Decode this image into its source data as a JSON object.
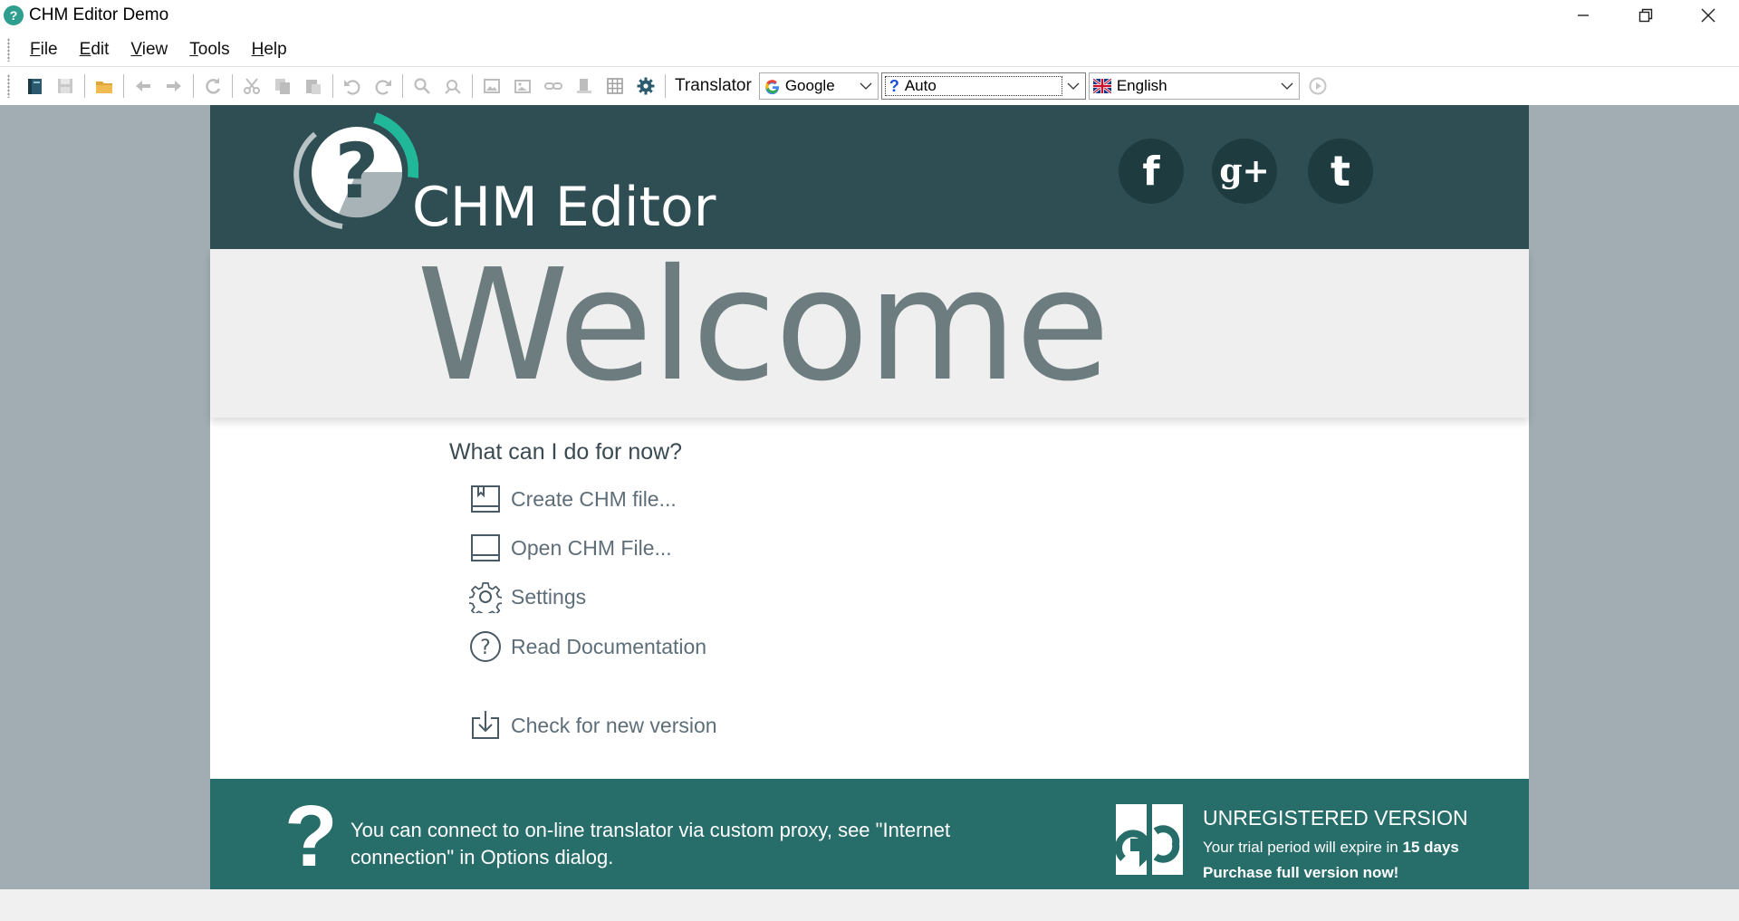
{
  "window": {
    "title": "CHM Editor Demo",
    "minimize_icon": "minimize-icon",
    "restore_icon": "restore-icon",
    "close_icon": "close-icon"
  },
  "menu": {
    "items": [
      {
        "accel": "F",
        "rest": "ile"
      },
      {
        "accel": "E",
        "rest": "dit"
      },
      {
        "accel": "V",
        "rest": "iew"
      },
      {
        "accel": "T",
        "rest": "ools"
      },
      {
        "accel": "H",
        "rest": "elp"
      }
    ]
  },
  "toolbar": {
    "translator_label": "Translator",
    "engine": "Google",
    "source_lang": "Auto",
    "target_lang": "English"
  },
  "header": {
    "brand": "CHM Editor",
    "social": [
      "f",
      "g+",
      "t"
    ]
  },
  "welcome": {
    "heading": "Welcome",
    "question": "What can I do for now?",
    "actions": [
      {
        "label": "Create CHM file...",
        "icon": "book-bookmark-icon"
      },
      {
        "label": "Open CHM File...",
        "icon": "book-icon"
      },
      {
        "label": "Settings",
        "icon": "gear-icon"
      },
      {
        "label": "Read Documentation",
        "icon": "question-circle-icon"
      },
      {
        "label": "Check for new version",
        "icon": "download-icon"
      }
    ]
  },
  "footer": {
    "tip": "You can connect to on-line translator via custom proxy, see \"Internet connection\" in Options dialog.",
    "unregistered_title": "UNREGISTERED VERSION",
    "trial_prefix": "Your trial period will expire in ",
    "trial_days": "15 days",
    "purchase": "Purchase full version now!"
  },
  "colors": {
    "header_bg": "#2e4e54",
    "footer_bg": "#276d6a",
    "workspace_bg": "#a1acb3",
    "accent": "#21b89a"
  }
}
